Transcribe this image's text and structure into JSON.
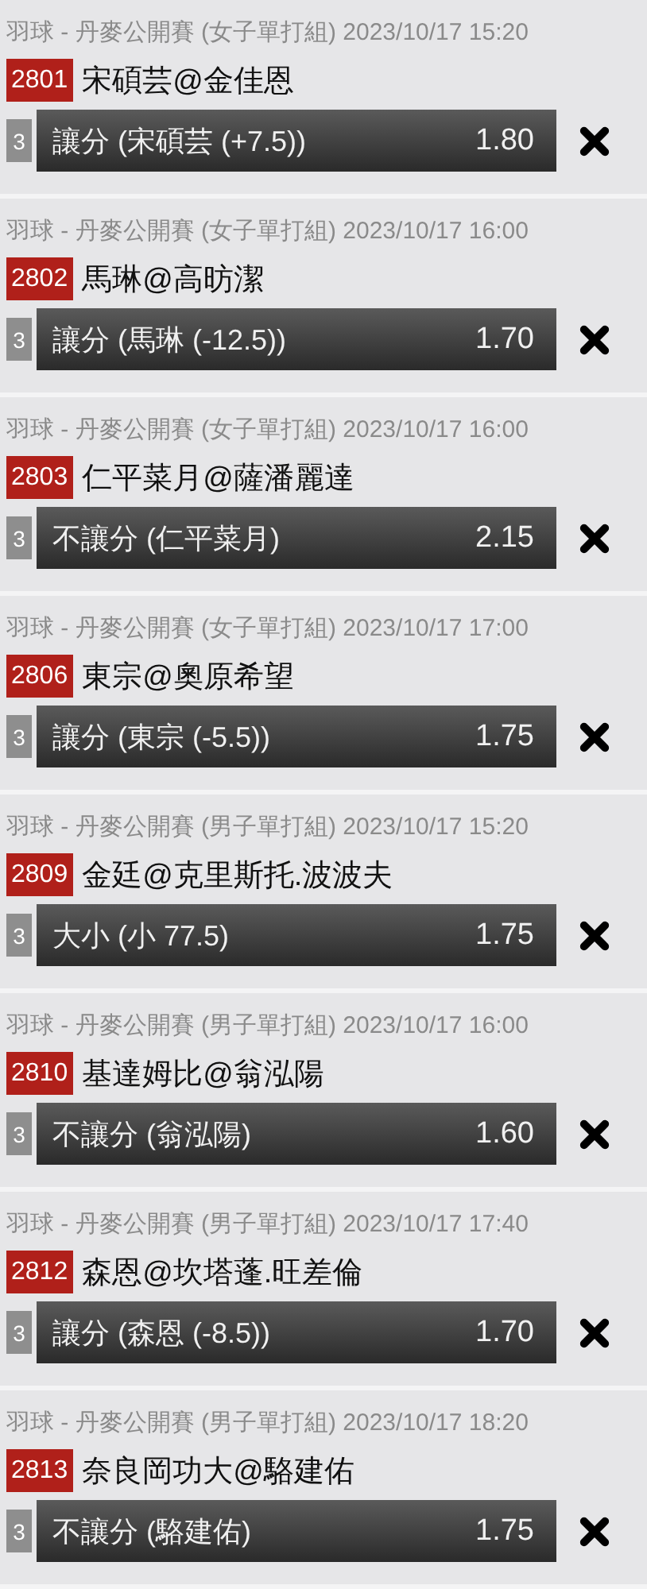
{
  "bets": [
    {
      "league": "羽球 - 丹麥公開賽 (女子單打組) 2023/10/17 15:20",
      "code": "2801",
      "match": "宋碩芸@金佳恩",
      "leg": "3",
      "selection": "讓分 (宋碩芸 (+7.5))",
      "odds": "1.80"
    },
    {
      "league": "羽球 - 丹麥公開賽 (女子單打組) 2023/10/17 16:00",
      "code": "2802",
      "match": "馬琳@高昉潔",
      "leg": "3",
      "selection": "讓分 (馬琳 (-12.5))",
      "odds": "1.70"
    },
    {
      "league": "羽球 - 丹麥公開賽 (女子單打組) 2023/10/17 16:00",
      "code": "2803",
      "match": "仁平菜月@薩潘麗達",
      "leg": "3",
      "selection": "不讓分 (仁平菜月)",
      "odds": "2.15"
    },
    {
      "league": "羽球 - 丹麥公開賽 (女子單打組) 2023/10/17 17:00",
      "code": "2806",
      "match": "東宗@奧原希望",
      "leg": "3",
      "selection": "讓分 (東宗 (-5.5))",
      "odds": "1.75"
    },
    {
      "league": "羽球 - 丹麥公開賽 (男子單打組) 2023/10/17 15:20",
      "code": "2809",
      "match": "金廷@克里斯托.波波夫",
      "leg": "3",
      "selection": "大小 (小 77.5)",
      "odds": "1.75"
    },
    {
      "league": "羽球 - 丹麥公開賽 (男子單打組) 2023/10/17 16:00",
      "code": "2810",
      "match": "基達姆比@翁泓陽",
      "leg": "3",
      "selection": "不讓分 (翁泓陽)",
      "odds": "1.60"
    },
    {
      "league": "羽球 - 丹麥公開賽 (男子單打組) 2023/10/17 17:40",
      "code": "2812",
      "match": "森恩@坎塔蓬.旺差倫",
      "leg": "3",
      "selection": "讓分 (森恩 (-8.5))",
      "odds": "1.70"
    },
    {
      "league": "羽球 - 丹麥公開賽 (男子單打組) 2023/10/17 18:20",
      "code": "2813",
      "match": "奈良岡功大@駱建佑",
      "leg": "3",
      "selection": "不讓分 (駱建佑)",
      "odds": "1.75"
    }
  ]
}
